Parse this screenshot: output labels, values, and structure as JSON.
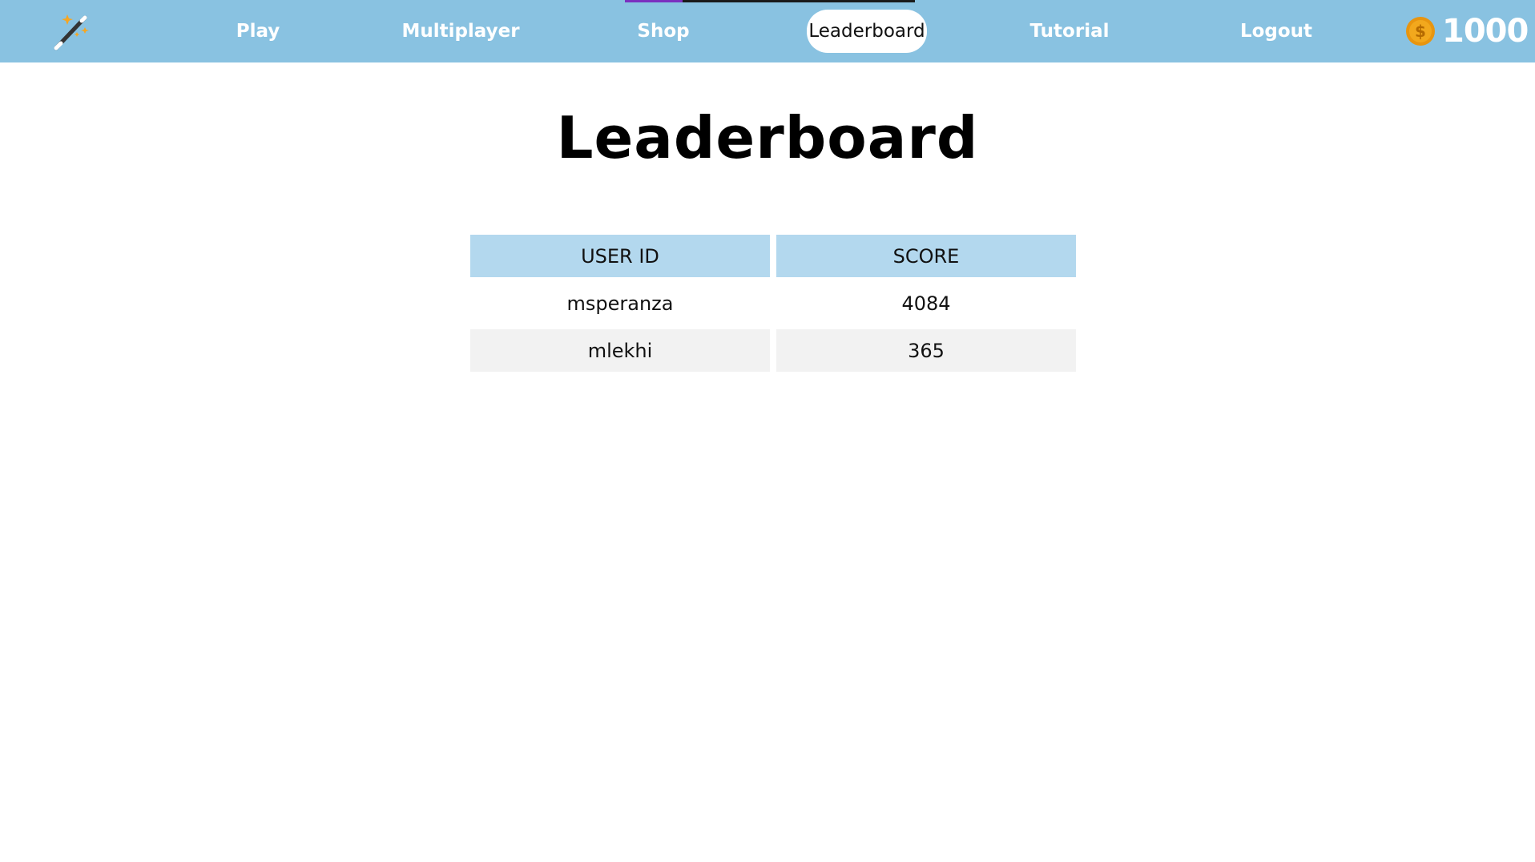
{
  "nav": {
    "logo_icon": "magic-wand-icon",
    "items": [
      {
        "label": "Play"
      },
      {
        "label": "Multiplayer"
      },
      {
        "label": "Shop"
      },
      {
        "label": "Leaderboard",
        "active": true
      },
      {
        "label": "Tutorial"
      },
      {
        "label": "Logout"
      }
    ],
    "coins": {
      "icon": "coin-icon",
      "symbol": "$",
      "amount": "1000"
    }
  },
  "page": {
    "title": "Leaderboard"
  },
  "table": {
    "headers": [
      "USER ID",
      "SCORE"
    ],
    "rows": [
      {
        "user_id": "msperanza",
        "score": "4084"
      },
      {
        "user_id": "mlekhi",
        "score": "365"
      }
    ]
  },
  "colors": {
    "nav_background": "#89c2e1",
    "header_cell": "#b3d8ee",
    "striped_row": "#f2f2f2",
    "coin": "#f2a81d",
    "progress_fill": "#7b2fbf"
  }
}
